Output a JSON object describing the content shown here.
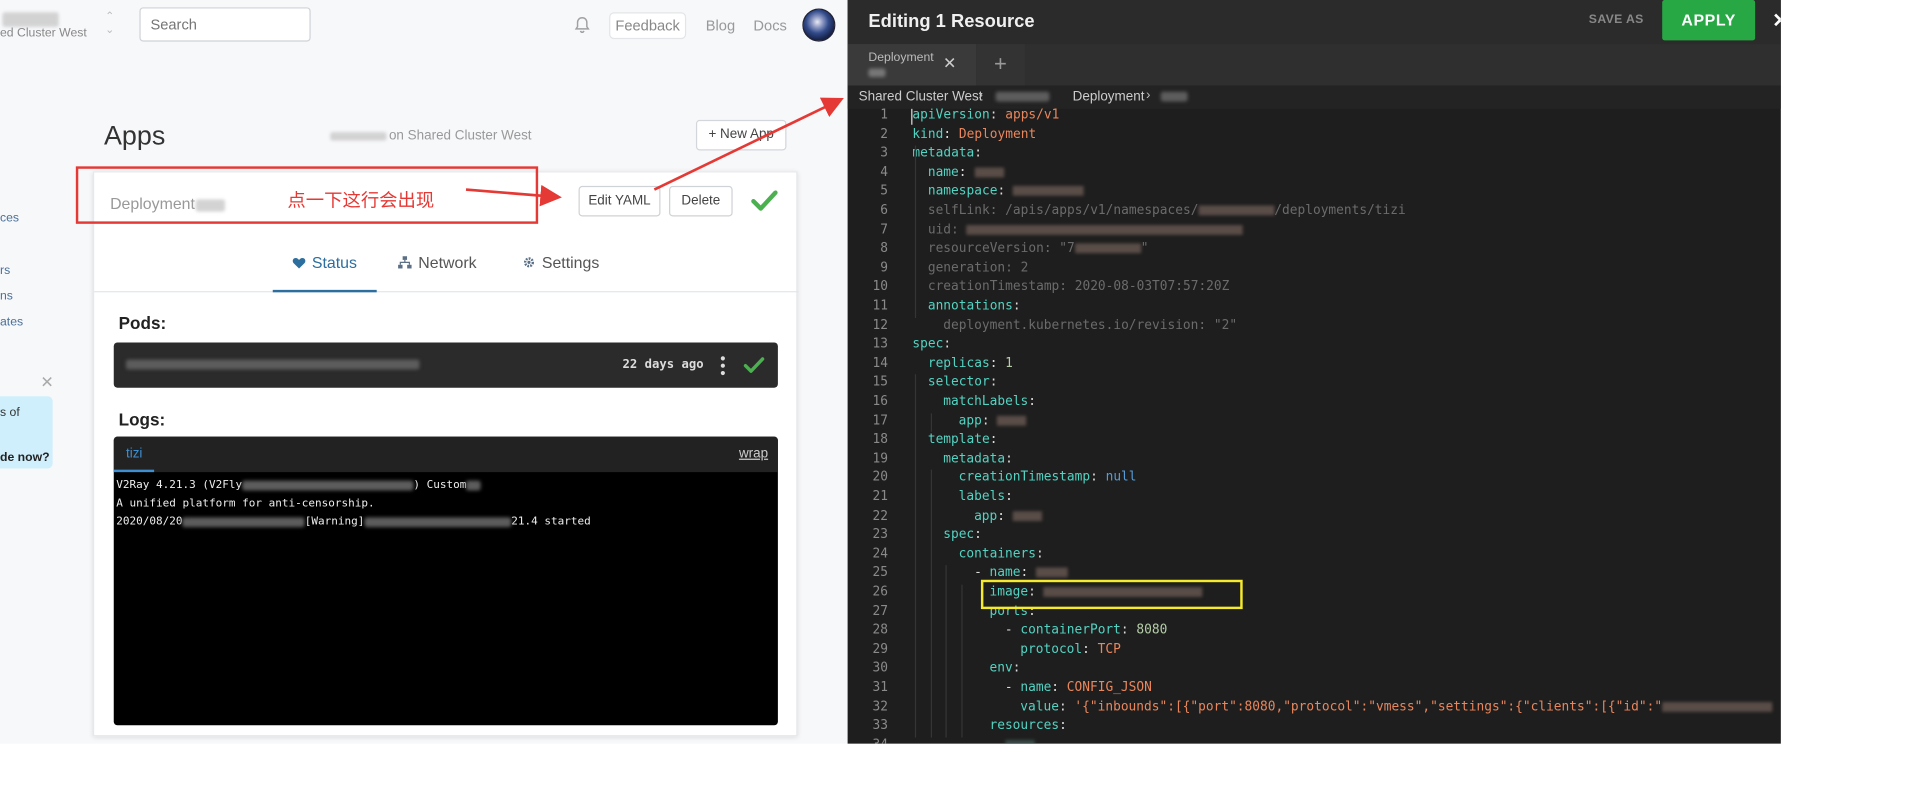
{
  "topbar": {
    "cluster_name": "ed Cluster West",
    "search_placeholder": "Search",
    "feedback_label": "Feedback",
    "blog_label": "Blog",
    "docs_label": "Docs",
    "icons": [
      "bell-icon",
      "avatar"
    ]
  },
  "page": {
    "title": "Apps",
    "subtitle": "on Shared Cluster West",
    "new_app_label": "New App"
  },
  "sidebar": {
    "fragments": [
      "ces",
      "rs",
      "ns",
      "ates"
    ],
    "promo_line1": "s of",
    "promo_line2": "de now?"
  },
  "card": {
    "kind_label": "Deployment",
    "annotation_note": "点一下这行会出现",
    "edit_yaml_label": "Edit YAML",
    "delete_label": "Delete",
    "tabs": [
      {
        "label": "Status",
        "icon": "heart-icon"
      },
      {
        "label": "Network",
        "icon": "network-icon"
      },
      {
        "label": "Settings",
        "icon": "gear-icon"
      }
    ],
    "pods_heading": "Pods:",
    "pod_age": "22 days ago",
    "logs_heading": "Logs:",
    "logs_tab": "tizi",
    "wrap_label": "wrap",
    "log_lines": [
      {
        "prefix": "V2Ray 4.21.3 (V2Fly",
        "suffix": ") Custom"
      },
      {
        "prefix": "A unified platform for anti-censorship.",
        "suffix": ""
      },
      {
        "prefix": "2020/08/20",
        "middle": "[Warning]",
        "suffix": "21.4 started"
      }
    ]
  },
  "editor": {
    "title": "Editing 1 Resource",
    "save_as_label": "SAVE AS",
    "apply_label": "APPLY",
    "close_symbol": "✕",
    "file_tab_label": "Deployment",
    "file_tab_close": "✕",
    "add_tab_symbol": "+",
    "breadcrumb": {
      "cluster": "Shared Cluster West",
      "kind": "Deployment"
    },
    "code_lines": [
      {
        "n": "1",
        "indent": 0,
        "key": "apiVersion",
        "value": "apps/v1",
        "vclass": "v"
      },
      {
        "n": "2",
        "indent": 0,
        "key": "kind",
        "value": "Deployment",
        "vclass": "v"
      },
      {
        "n": "3",
        "indent": 0,
        "key": "metadata",
        "value": ""
      },
      {
        "n": "4",
        "indent": 1,
        "key": "name",
        "value": "",
        "redacted": 24
      },
      {
        "n": "5",
        "indent": 1,
        "key": "namespace",
        "value": "",
        "redacted": 58
      },
      {
        "n": "6",
        "indent": 1,
        "dim": true,
        "text": "selfLink: /apis/apps/v1/namespaces/",
        "redacted": 62,
        "tail": "/deployments/tizi"
      },
      {
        "n": "7",
        "indent": 1,
        "dim": true,
        "text": "uid: ",
        "redacted": 226
      },
      {
        "n": "8",
        "indent": 1,
        "dim": true,
        "text": "resourceVersion: \"7",
        "redacted": 54,
        "tail": "\""
      },
      {
        "n": "9",
        "indent": 1,
        "dim": true,
        "text": "generation: 2"
      },
      {
        "n": "10",
        "indent": 1,
        "dim": true,
        "text": "creationTimestamp: 2020-08-03T07:57:20Z"
      },
      {
        "n": "11",
        "indent": 1,
        "key": "annotations",
        "value": ""
      },
      {
        "n": "12",
        "indent": 2,
        "dim": true,
        "text": "deployment.kubernetes.io/revision: \"2\""
      },
      {
        "n": "13",
        "indent": 0,
        "key": "spec",
        "value": ""
      },
      {
        "n": "14",
        "indent": 1,
        "key": "replicas",
        "value": "1",
        "vclass": "num"
      },
      {
        "n": "15",
        "indent": 1,
        "key": "selector",
        "value": ""
      },
      {
        "n": "16",
        "indent": 2,
        "key": "matchLabels",
        "value": ""
      },
      {
        "n": "17",
        "indent": 3,
        "key": "app",
        "value": "",
        "redacted": 24
      },
      {
        "n": "18",
        "indent": 1,
        "key": "template",
        "value": ""
      },
      {
        "n": "19",
        "indent": 2,
        "key": "metadata",
        "value": ""
      },
      {
        "n": "20",
        "indent": 3,
        "key": "creationTimestamp",
        "value": "null",
        "vclass": "nul"
      },
      {
        "n": "21",
        "indent": 3,
        "key": "labels",
        "value": ""
      },
      {
        "n": "22",
        "indent": 4,
        "key": "app",
        "value": "",
        "redacted": 24
      },
      {
        "n": "23",
        "indent": 2,
        "key": "spec",
        "value": ""
      },
      {
        "n": "24",
        "indent": 3,
        "key": "containers",
        "value": ""
      },
      {
        "n": "25",
        "indent": 4,
        "dash": true,
        "key": "name",
        "value": "",
        "redacted": 26
      },
      {
        "n": "26",
        "indent": 5,
        "key": "image",
        "value": "",
        "redacted": 130
      },
      {
        "n": "27",
        "indent": 5,
        "key": "ports",
        "value": ""
      },
      {
        "n": "28",
        "indent": 6,
        "dash": true,
        "key": "containerPort",
        "value": "8080",
        "vclass": "num"
      },
      {
        "n": "29",
        "indent": 7,
        "key": "protocol",
        "value": "TCP",
        "vclass": "v"
      },
      {
        "n": "30",
        "indent": 5,
        "key": "env",
        "value": ""
      },
      {
        "n": "31",
        "indent": 6,
        "dash": true,
        "key": "name",
        "value": "CONFIG_JSON",
        "vclass": "v"
      },
      {
        "n": "32",
        "indent": 7,
        "key": "value",
        "value": "'{\"inbounds\":[{\"port\":8080,\"protocol\":\"vmess\",\"settings\":{\"clients\":[{\"id\":\"",
        "vclass": "v",
        "redacted": 90
      },
      {
        "n": "33",
        "indent": 5,
        "key": "resources",
        "value": ""
      },
      {
        "n": "34",
        "indent": 6,
        "key": "",
        "value": "",
        "partial": true
      }
    ]
  },
  "colors": {
    "accent_blue": "#2c6e9e",
    "apply_green": "#28a745",
    "annotation_red": "#e53935",
    "highlight_yellow": "#f6ea2c",
    "yaml_key": "#53d3c2",
    "yaml_string": "#e9865c"
  }
}
